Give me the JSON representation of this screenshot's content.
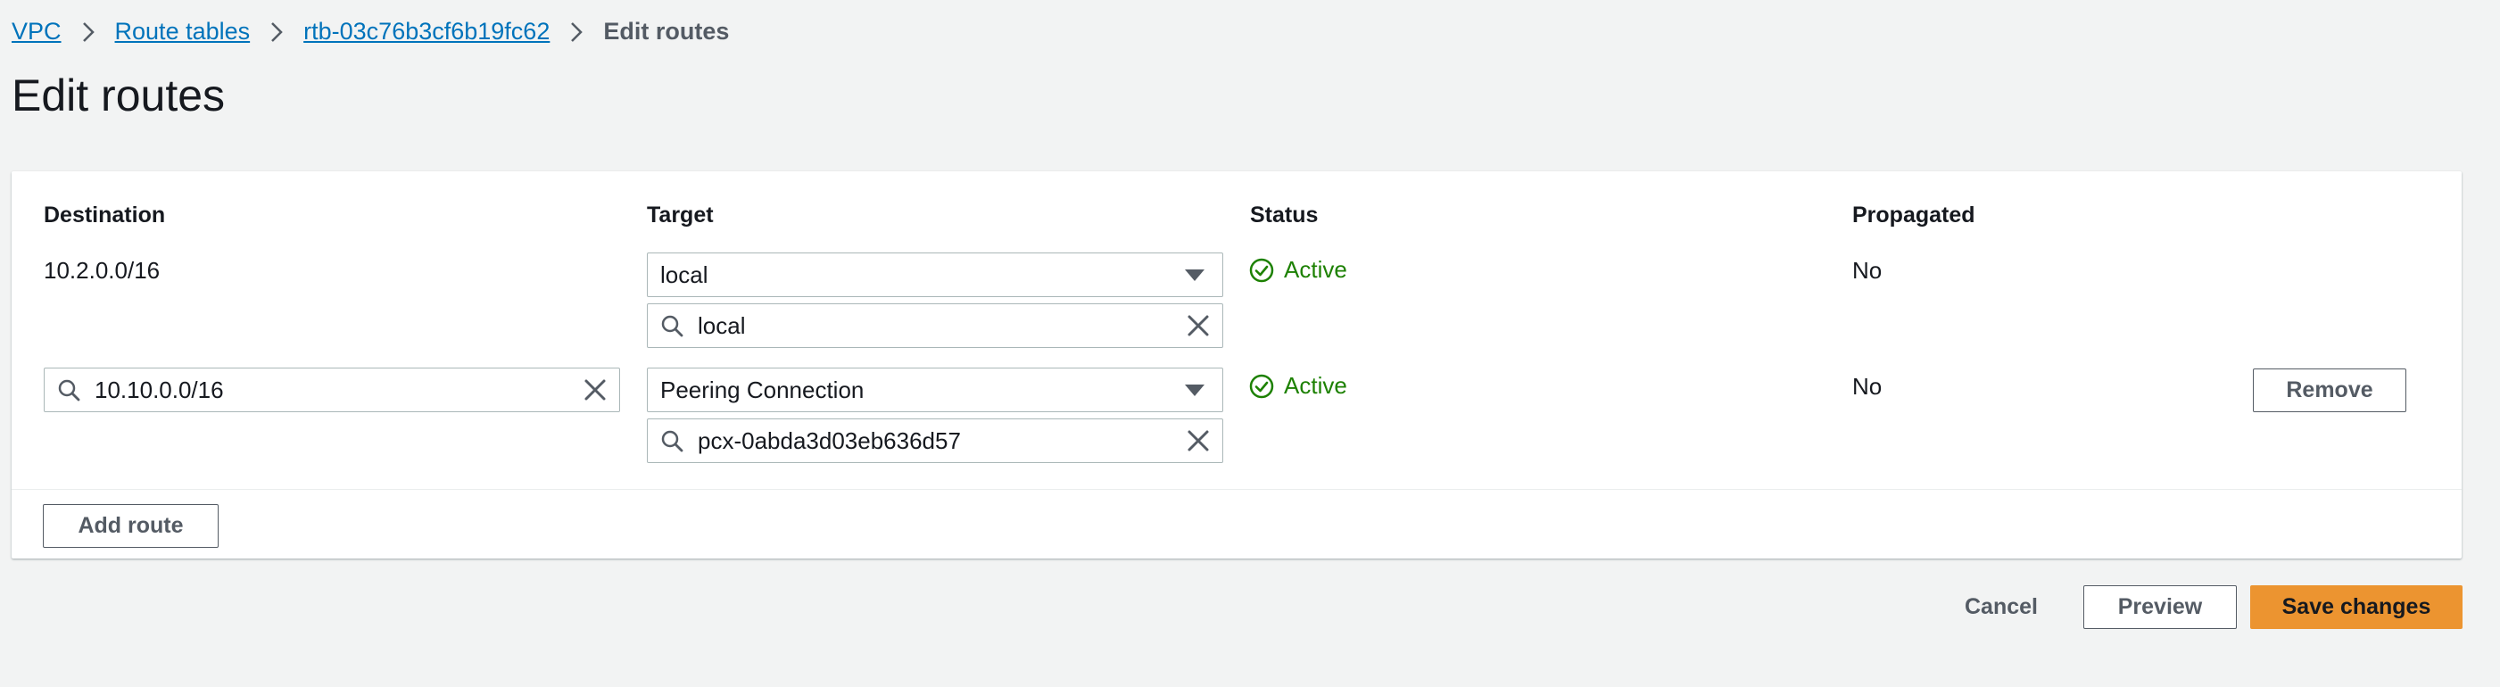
{
  "breadcrumb": {
    "items": [
      "VPC",
      "Route tables",
      "rtb-03c76b3cf6b19fc62"
    ],
    "current": "Edit routes"
  },
  "page": {
    "title": "Edit routes"
  },
  "table": {
    "headers": {
      "destination": "Destination",
      "target": "Target",
      "status": "Status",
      "propagated": "Propagated"
    },
    "rows": [
      {
        "destination": "10.2.0.0/16",
        "target_type": "local",
        "target_value": "local",
        "status": "Active",
        "propagated": "No"
      },
      {
        "destination": "10.10.0.0/16",
        "target_type": "Peering Connection",
        "target_value": "pcx-0abda3d03eb636d57",
        "status": "Active",
        "propagated": "No",
        "remove_label": "Remove"
      }
    ]
  },
  "actions": {
    "add_route": "Add route",
    "cancel": "Cancel",
    "preview": "Preview",
    "save": "Save changes"
  },
  "icons": {
    "breadcrumb_separator": "chevron-right-icon",
    "search": "search-icon",
    "clear": "close-icon",
    "dropdown": "caret-down-icon",
    "status_ok": "status-positive-icon"
  },
  "colors": {
    "link": "#0073bb",
    "status_positive": "#1d8102",
    "primary_button": "#ec9430",
    "page_background": "#f2f3f3"
  }
}
